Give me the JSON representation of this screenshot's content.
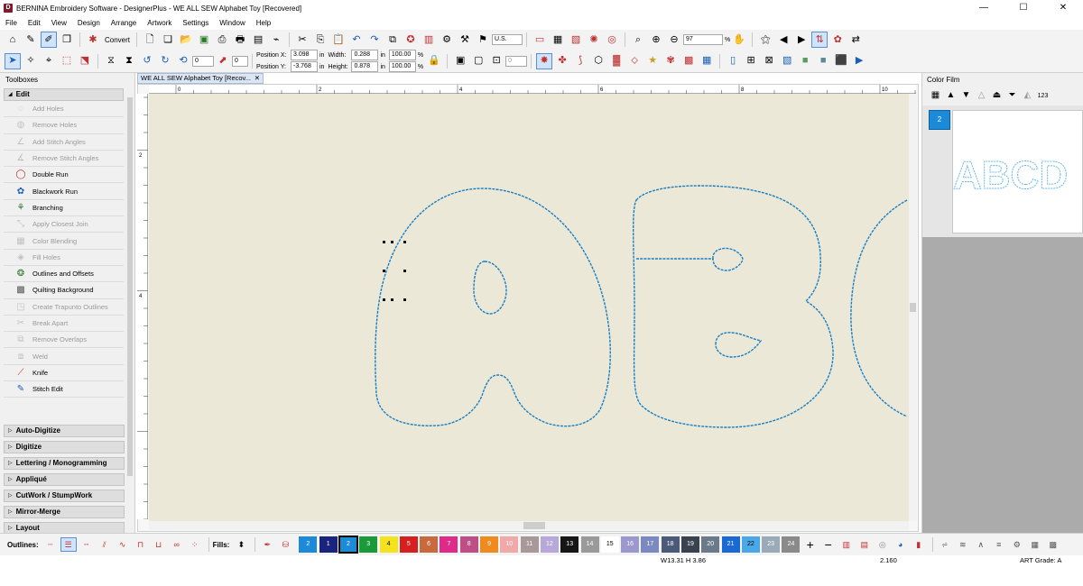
{
  "window": {
    "title": "BERNINA Embroidery Software - DesignerPlus - WE ALL SEW Alphabet Toy [Recovered]",
    "app_icon_letter": "D",
    "controls": [
      "—",
      "☐",
      "✕"
    ]
  },
  "menu": [
    "File",
    "Edit",
    "View",
    "Design",
    "Arrange",
    "Artwork",
    "Settings",
    "Window",
    "Help"
  ],
  "toolbar1": {
    "convert_label": "Convert",
    "units": "U.S.",
    "zoom": "97",
    "zoom_unit": "%"
  },
  "toolbar2": {
    "rotate_value": "0",
    "slant_value": "0",
    "position_x_label": "Position X:",
    "position_x": "3.098",
    "position_y_label": "Position Y:",
    "position_y": "-3.768",
    "pos_unit": "in",
    "width_label": "Width:",
    "width": "0.288",
    "height_label": "Height:",
    "height": "0.878",
    "size_unit": "in",
    "scale_w": "100.00",
    "scale_h": "100.00",
    "scale_unit": "%",
    "stitch_count": "0"
  },
  "toolboxes": {
    "title": "Toolboxes",
    "edit_group": "Edit",
    "items": [
      {
        "label": "Add Holes",
        "icon": "add-holes-icon",
        "glyph": "◌",
        "enabled": false
      },
      {
        "label": "Remove Holes",
        "icon": "remove-holes-icon",
        "glyph": "◍",
        "enabled": false
      },
      {
        "label": "Add Stitch Angles",
        "icon": "add-stitch-angles-icon",
        "glyph": "∠",
        "enabled": false
      },
      {
        "label": "Remove Stitch Angles",
        "icon": "remove-stitch-angles-icon",
        "glyph": "∡",
        "enabled": false
      },
      {
        "label": "Double Run",
        "icon": "double-run-icon",
        "glyph": "◯",
        "enabled": true
      },
      {
        "label": "Blackwork Run",
        "icon": "blackwork-run-icon",
        "glyph": "✿",
        "enabled": true
      },
      {
        "label": "Branching",
        "icon": "branching-icon",
        "glyph": "⚘",
        "enabled": true
      },
      {
        "label": "Apply Closest Join",
        "icon": "closest-join-icon",
        "glyph": "⤡",
        "enabled": false
      },
      {
        "label": "Color Blending",
        "icon": "color-blending-icon",
        "glyph": "▦",
        "enabled": false
      },
      {
        "label": "Fill Holes",
        "icon": "fill-holes-icon",
        "glyph": "◈",
        "enabled": false
      },
      {
        "label": "Outlines and Offsets",
        "icon": "outlines-offsets-icon",
        "glyph": "❂",
        "enabled": true
      },
      {
        "label": "Quilting Background",
        "icon": "quilting-background-icon",
        "glyph": "▩",
        "enabled": true
      },
      {
        "label": "Create Trapunto Outlines",
        "icon": "trapunto-icon",
        "glyph": "◳",
        "enabled": false
      },
      {
        "label": "Break Apart",
        "icon": "break-apart-icon",
        "glyph": "✂",
        "enabled": false
      },
      {
        "label": "Remove Overlaps",
        "icon": "remove-overlaps-icon",
        "glyph": "⧉",
        "enabled": false
      },
      {
        "label": "Weld",
        "icon": "weld-icon",
        "glyph": "⧈",
        "enabled": false
      },
      {
        "label": "Knife",
        "icon": "knife-icon",
        "glyph": "⟋",
        "enabled": true
      },
      {
        "label": "Stitch Edit",
        "icon": "stitch-edit-icon",
        "glyph": "✎",
        "enabled": true
      }
    ],
    "collapsed_groups": [
      "Auto-Digitize",
      "Digitize",
      "Lettering / Monogramming",
      "Appliqué",
      "CutWork / StumpWork",
      "Mirror-Merge",
      "Layout"
    ]
  },
  "document": {
    "tab_title": "WE ALL SEW Alphabet Toy [Recov...",
    "ruler_labels": [
      "0",
      "2",
      "4",
      "6",
      "8",
      "10"
    ],
    "vruler_labels": [
      "2",
      "4"
    ],
    "canvas_color": "#ebe8d8",
    "stitch_color": "#1a7fc4"
  },
  "color_film": {
    "title": "Color Film",
    "chip_label": "2",
    "thumbnail_text": "ABCD",
    "toolbar_icons": [
      "color-film-grid-icon",
      "move-bottom-icon",
      "move-down-icon",
      "move-up-icon",
      "move-top-icon",
      "fill-top-icon",
      "number-sequence-icon"
    ]
  },
  "bottom": {
    "outlines_label": "Outlines:",
    "fills_label": "Fills:",
    "palette": [
      {
        "n": "2",
        "color": "#1b8ad8",
        "text": "#ffffff"
      },
      {
        "n": "1",
        "color": "#1a237e",
        "text": "#ffffff"
      },
      {
        "n": "2",
        "color": "#1b8ad8",
        "text": "#ffffff",
        "selected": true
      },
      {
        "n": "3",
        "color": "#1b9a3a",
        "text": "#ffffff"
      },
      {
        "n": "4",
        "color": "#f4e21a",
        "text": "#000000"
      },
      {
        "n": "5",
        "color": "#d62020",
        "text": "#ffffff"
      },
      {
        "n": "6",
        "color": "#c86a3c",
        "text": "#ffffff"
      },
      {
        "n": "7",
        "color": "#e02a8a",
        "text": "#ffffff"
      },
      {
        "n": "8",
        "color": "#c04e86",
        "text": "#ffffff"
      },
      {
        "n": "9",
        "color": "#ee8a1e",
        "text": "#ffffff"
      },
      {
        "n": "10",
        "color": "#f0a8a8",
        "text": "#ffffff"
      },
      {
        "n": "11",
        "color": "#a89898",
        "text": "#ffffff"
      },
      {
        "n": "12",
        "color": "#b6a8d8",
        "text": "#ffffff"
      },
      {
        "n": "13",
        "color": "#161616",
        "text": "#ffffff"
      },
      {
        "n": "14",
        "color": "#9a9a9a",
        "text": "#ffffff"
      },
      {
        "n": "15",
        "color": "#ffffff",
        "text": "#000000"
      },
      {
        "n": "16",
        "color": "#9a98cc",
        "text": "#ffffff"
      },
      {
        "n": "17",
        "color": "#7a8ac0",
        "text": "#ffffff"
      },
      {
        "n": "18",
        "color": "#4c5a7a",
        "text": "#ffffff"
      },
      {
        "n": "19",
        "color": "#3a4250",
        "text": "#ffffff"
      },
      {
        "n": "20",
        "color": "#6a7a8a",
        "text": "#ffffff"
      },
      {
        "n": "21",
        "color": "#1a6ad6",
        "text": "#ffffff"
      },
      {
        "n": "22",
        "color": "#4aa8e8",
        "text": "#000000"
      },
      {
        "n": "23",
        "color": "#9aaab8",
        "text": "#ffffff"
      },
      {
        "n": "24",
        "color": "#8a8a8a",
        "text": "#ffffff"
      }
    ]
  },
  "status": {
    "dimensions": "W13.31 H 3.86",
    "zoom_value": "2.160",
    "art_grade": "ART Grade: A"
  }
}
